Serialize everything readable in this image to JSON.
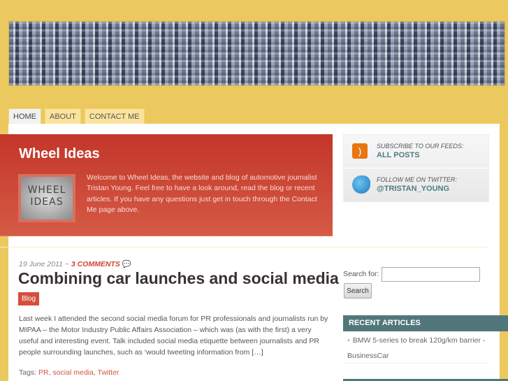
{
  "nav": {
    "tabs": [
      {
        "label": "HOME"
      },
      {
        "label": "ABOUT"
      },
      {
        "label": "CONTACT ME"
      }
    ]
  },
  "banner": {
    "title": "Wheel Ideas",
    "logo_text": "WHEEL IDEAS",
    "intro": "Welcome to Wheel Ideas, the website and blog of automotive journalist Tristan Young. Feel free to have a look around, read the blog or recent articles. If you have any questions just get in touch through the Contact Me page above."
  },
  "feeds": {
    "subscribe_label": "SUBSCRIBE TO OUR FEEDS:",
    "subscribe_link": "ALL POSTS",
    "twitter_label": "FOLLOW ME ON TWITTER:",
    "twitter_link": "@TRISTAN_YOUNG"
  },
  "post": {
    "date": "19 June 2011",
    "sep": " ~ ",
    "comments": "3 COMMENTS",
    "title": "Combining car launches and social media",
    "category": "Blog",
    "excerpt": "Last week I attended the second social media forum for PR professionals and journalists run by MIPAA – the Motor Industry Public Affairs Association – which was (as with the first) a very useful and interesting event. Talk included social media etiquette between journalists and PR people surrounding launches, such as ‘would tweeting information from […]",
    "tags_label": "Tags:",
    "tags": [
      "PR",
      "social media",
      "Twitter"
    ]
  },
  "search": {
    "label": "Search for:",
    "value": "",
    "button": "Search"
  },
  "recent": {
    "heading": "RECENT ARTICLES",
    "items": [
      "BMW 5-series to break 120g/km barrier - BusinessCar"
    ]
  }
}
